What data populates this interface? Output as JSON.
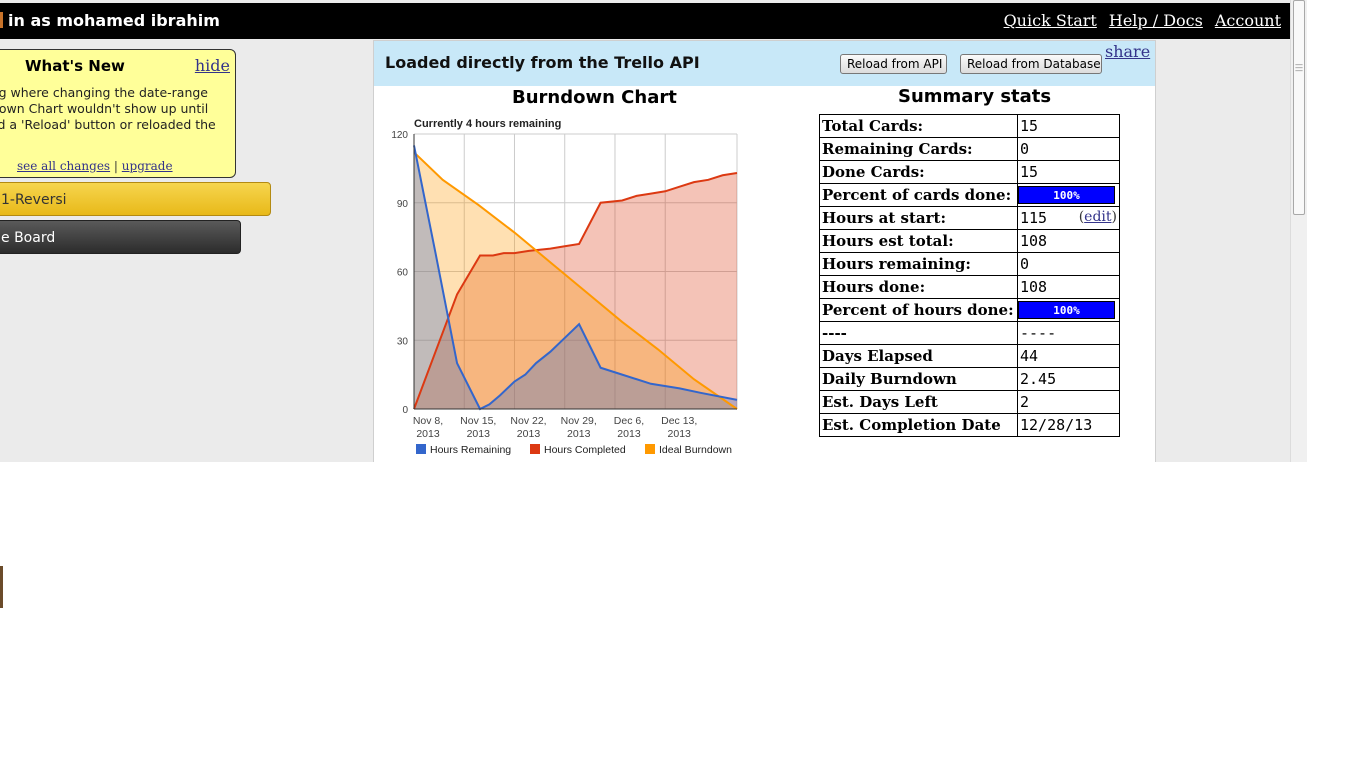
{
  "header": {
    "logo_fragment": "",
    "user_text": "in as mohamed ibrahim",
    "nav": [
      "Quick Start",
      "Help / Docs",
      "Account"
    ]
  },
  "whats_new": {
    "title": "What's New",
    "hide_label": "hide",
    "body_lines": [
      "oug where changing the date-range",
      "ndown Chart wouldn't show up until",
      "ked a 'Reload' button or reloaded the"
    ],
    "see_all_label": "see all changes",
    "separator": "|",
    "upgrade_label": "upgrade"
  },
  "boards": [
    "1-Reversi",
    "e Board"
  ],
  "panel": {
    "title": "Loaded directly from the Trello API",
    "reload_api_label": "Reload from API",
    "reload_db_label": "Reload from Database",
    "share_label": "share"
  },
  "chart_heading": "Burndown Chart",
  "chart_data": {
    "type": "area",
    "title": "Currently 4 hours remaining",
    "x_tick_labels": [
      [
        "Nov 8,",
        "2013"
      ],
      [
        "Nov 15,",
        "2013"
      ],
      [
        "Nov 22,",
        "2013"
      ],
      [
        "Nov 29,",
        "2013"
      ],
      [
        "Dec 6,",
        "2013"
      ],
      [
        "Dec 13,",
        "2013"
      ]
    ],
    "x_tick_days": [
      0,
      7,
      14,
      21,
      28,
      35
    ],
    "xlim": [
      0,
      45
    ],
    "ylim": [
      0,
      120
    ],
    "y_ticks": [
      0,
      30,
      60,
      90,
      120
    ],
    "grid": true,
    "legend_position": "bottom",
    "series": [
      {
        "name": "Hours Remaining",
        "color": "#3366cc",
        "points": [
          [
            0,
            115
          ],
          [
            3,
            68
          ],
          [
            6,
            20
          ],
          [
            9.2,
            0
          ],
          [
            10.5,
            2
          ],
          [
            12,
            6
          ],
          [
            14,
            12
          ],
          [
            15.5,
            15
          ],
          [
            17,
            20
          ],
          [
            19,
            25
          ],
          [
            21,
            31
          ],
          [
            23,
            37
          ],
          [
            26,
            18
          ],
          [
            29,
            15
          ],
          [
            33,
            11
          ],
          [
            37,
            9
          ],
          [
            40,
            7
          ],
          [
            45,
            4
          ]
        ]
      },
      {
        "name": "Hours Completed",
        "color": "#dc3912",
        "points": [
          [
            0,
            0
          ],
          [
            3,
            25
          ],
          [
            6,
            50
          ],
          [
            9.2,
            67
          ],
          [
            11,
            67
          ],
          [
            12.5,
            68
          ],
          [
            14,
            68
          ],
          [
            16,
            69
          ],
          [
            19,
            70
          ],
          [
            21,
            71
          ],
          [
            23,
            72
          ],
          [
            26,
            90
          ],
          [
            29,
            91
          ],
          [
            31,
            93
          ],
          [
            33,
            94
          ],
          [
            35,
            95
          ],
          [
            37,
            97
          ],
          [
            39,
            99
          ],
          [
            41,
            100
          ],
          [
            43,
            102
          ],
          [
            45,
            103
          ]
        ]
      },
      {
        "name": "Ideal Burndown",
        "color": "#ff9900",
        "points": [
          [
            0,
            112
          ],
          [
            4,
            100
          ],
          [
            9,
            89
          ],
          [
            14,
            77
          ],
          [
            19,
            64
          ],
          [
            24,
            51
          ],
          [
            29,
            38
          ],
          [
            34,
            26
          ],
          [
            39,
            13
          ],
          [
            45,
            0
          ]
        ]
      }
    ]
  },
  "stats": {
    "heading": "Summary stats",
    "edit_label": "edit",
    "rows": [
      {
        "label": "Total Cards:",
        "value": "15"
      },
      {
        "label": "Remaining Cards:",
        "value": "0"
      },
      {
        "label": "Done Cards:",
        "value": "15"
      },
      {
        "label": "Percent of cards done:",
        "value": "100%",
        "bar": true,
        "fraction": 1.0
      },
      {
        "label": "Hours at start:",
        "value": "115",
        "edit": true
      },
      {
        "label": "Hours est total:",
        "value": "108"
      },
      {
        "label": "Hours remaining:",
        "value": "0"
      },
      {
        "label": "Hours done:",
        "value": "108"
      },
      {
        "label": "Percent of hours done:",
        "value": "100%",
        "bar": true,
        "fraction": 1.0
      },
      {
        "label": "----",
        "value": "----"
      },
      {
        "label": "Days Elapsed",
        "value": "44"
      },
      {
        "label": "Daily Burndown",
        "value": "2.45"
      },
      {
        "label": "Est. Days Left",
        "value": "2"
      },
      {
        "label": "Est. Completion Date",
        "value": "12/28/13"
      }
    ]
  }
}
